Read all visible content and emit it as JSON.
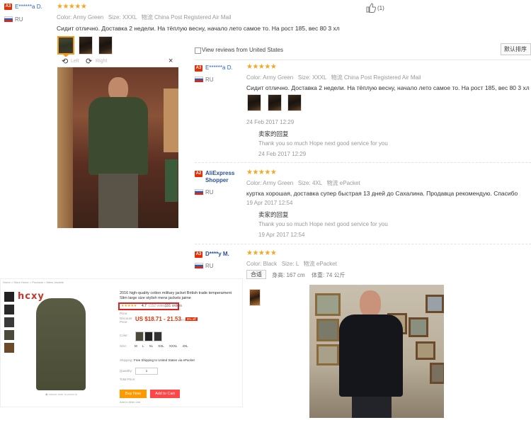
{
  "top_review": {
    "badge": "A3",
    "user": "E******a D.",
    "country": "RU",
    "color_label": "Color:",
    "color_value": "Army Green",
    "size_label": "Size:",
    "size_value": "XXXL",
    "shipping_label": "物流",
    "shipping_value": "China Post Registered Air Mail",
    "text": "Сидит отлично. Доставка 2 недели. На тёплую весну, начало лето самое то. На рост 185, вес 80 3 хл",
    "likes": "(1)",
    "viewer": {
      "rotate_left": "Left",
      "rotate_right": "Right",
      "close": "×"
    }
  },
  "filter": {
    "checkbox_label": "View reviews from United States",
    "sort_label": "默认排序"
  },
  "reviews": [
    {
      "badge": "A3",
      "user": "E******a D.",
      "country": "RU",
      "color_label": "Color:",
      "color_value": "Army Green",
      "size_label": "Size:",
      "size_value": "XXXL",
      "shipping_label": "物流",
      "shipping_value": "China Post Registered Air Mail",
      "text": "Сидит отлично. Доставка 2 недели. На тёплую весну, начало лето самое то. На рост 185, вес 80 3 хл",
      "date": "24 Feb 2017 12:29",
      "reply_heading": "卖家的回复",
      "reply_text": "Thank you so much Hope next good service for you",
      "reply_date": "24 Feb 2017 12:29"
    },
    {
      "badge": "A2",
      "user": "AliExpress Shopper",
      "country": "RU",
      "color_label": "Color:",
      "color_value": "Army Green",
      "size_label": "Size:",
      "size_value": "4XL",
      "shipping_label": "物流",
      "shipping_value": "ePacket",
      "text": "куртка хорошая, доставка супер быстрая 13 дней до Сахалина. Продавца рекомендую. Спасибо",
      "date": "19 Apr 2017 12:54",
      "reply_heading": "卖家的回复",
      "reply_text": "Thank you so much Hope next good service for you",
      "reply_date": "19 Apr 2017 12:54"
    },
    {
      "badge": "A3",
      "user": "D****y M.",
      "country": "RU",
      "color_label": "Color:",
      "color_value": "Black",
      "size_label": "Size:",
      "size_value": "L",
      "shipping_label": "物流",
      "shipping_value": "ePacket",
      "fit_tag": "合适",
      "height": "身高: 167 cm",
      "weight": "体重: 74 公斤"
    }
  ],
  "product": {
    "logo": "hcxy",
    "breadcrumb": "Home > Store Home > Products > Mens Jackets",
    "title": "2016 high-quality cotton military jacket British trade temperament Slim large size stylish mens jackets jaime",
    "rating": "4.7",
    "reviews": "(152 votes)",
    "orders": "191 orders",
    "price_label": "Price:",
    "discount_label": "Discount Price:",
    "price": "US $18.71 - 21.53",
    "price_unit": "/ piece",
    "off_badge": "9% off",
    "color_label": "Color:",
    "size_label": "Size:",
    "sizes": [
      "M",
      "L",
      "XL",
      "XXL",
      "XXXL",
      "4XL"
    ],
    "shipping_label": "Shipping:",
    "shipping_text": "Free Shipping to United States via ePacket",
    "quantity_label": "Quantity:",
    "quantity_value": "1",
    "total_label": "Total Price:",
    "buy_button": "Buy Now",
    "cart_button": "Add to Cart",
    "wishlist": "Add to Wish List"
  },
  "colors": {
    "star": "#f5a623",
    "badge": "#e62e04",
    "link": "#2a64c5",
    "price": "#e62e04",
    "buy": "#ff9900",
    "cart": "#ff4747"
  }
}
